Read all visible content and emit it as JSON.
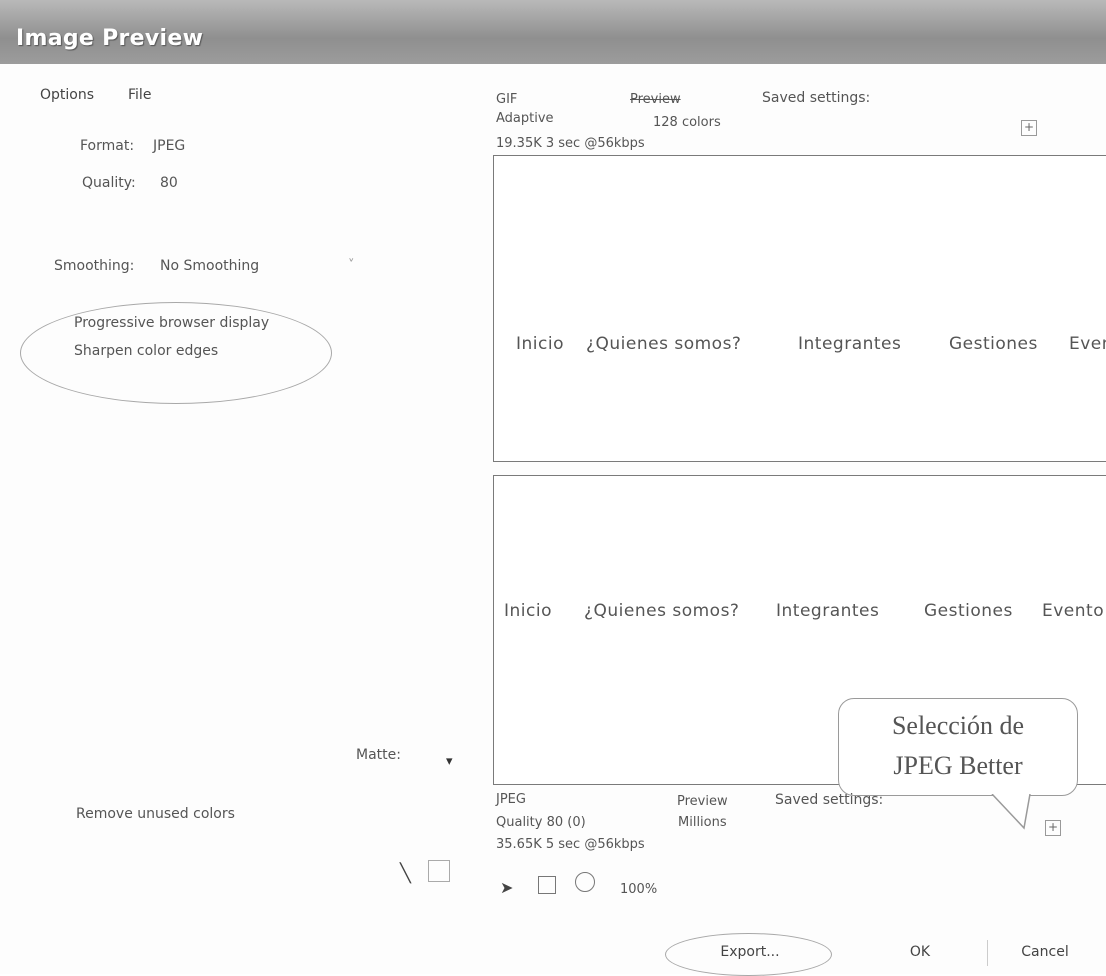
{
  "window": {
    "title": "Image Preview"
  },
  "menu": {
    "options": "Options",
    "file": "File"
  },
  "left": {
    "format_label": "Format:",
    "format_value": "JPEG",
    "quality_label": "Quality:",
    "quality_value": "80",
    "smoothing_label": "Smoothing:",
    "smoothing_value": "No Smoothing",
    "progressive": "Progressive browser display",
    "sharpen": "Sharpen color edges",
    "matte_label": "Matte:",
    "remove_unused": "Remove unused colors"
  },
  "top_preview": {
    "format": "GIF",
    "preview": "Preview",
    "saved_settings": "Saved settings:",
    "palette": "Adaptive",
    "colors": "128 colors",
    "size": "19.35K 3 sec @56kbps",
    "nav": [
      "Inicio",
      "¿Quienes somos?",
      "Integrantes",
      "Gestiones",
      "Event"
    ]
  },
  "bottom_preview": {
    "format": "JPEG",
    "preview": "Preview",
    "saved_settings": "Saved settings:",
    "quality": "Quality 80 (0)",
    "colors": "Millions",
    "size": "35.65K 5 sec @56kbps",
    "nav": [
      "Inicio",
      "¿Quienes somos?",
      "Integrantes",
      "Gestiones",
      "Evento"
    ]
  },
  "toolbar": {
    "zoom": "100%"
  },
  "callout": {
    "line1": "Selección de",
    "line2": "JPEG Better"
  },
  "buttons": {
    "export": "Export...",
    "ok": "OK",
    "cancel": "Cancel"
  }
}
